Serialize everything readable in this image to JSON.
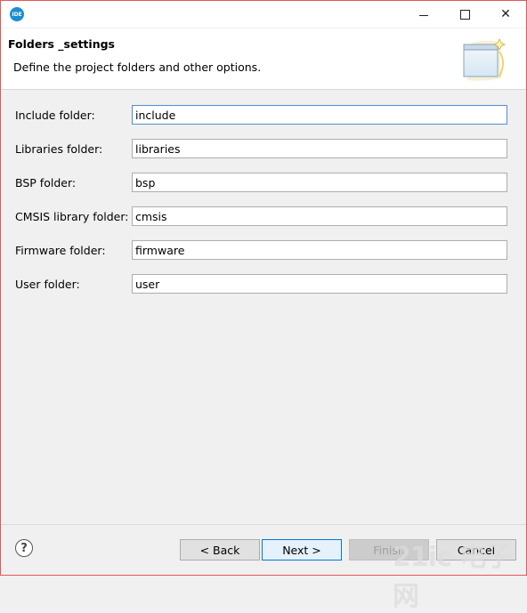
{
  "window": {
    "app_icon_text": "IDE",
    "controls": {
      "minimize": "minimize",
      "maximize": "maximize",
      "close": "✕"
    }
  },
  "header": {
    "title": "Folders _settings",
    "description": "Define the project folders and other options."
  },
  "form": {
    "fields": [
      {
        "label": "Include folder:",
        "value": "include"
      },
      {
        "label": "Libraries folder:",
        "value": "libraries"
      },
      {
        "label": "BSP folder:",
        "value": "bsp"
      },
      {
        "label": "CMSIS library folder:",
        "value": "cmsis"
      },
      {
        "label": "Firmware folder:",
        "value": "firmware"
      },
      {
        "label": "User folder:",
        "value": "user"
      }
    ]
  },
  "footer": {
    "help_label": "?",
    "back_label": "< Back",
    "next_label": "Next >",
    "finish_label": "Finish",
    "cancel_label": "Cancel"
  },
  "watermark": {
    "text": "21ic 电子网"
  },
  "colors": {
    "window_border": "#e25858",
    "focus_border": "#4f8fd1",
    "default_button_border": "#0078d7"
  }
}
